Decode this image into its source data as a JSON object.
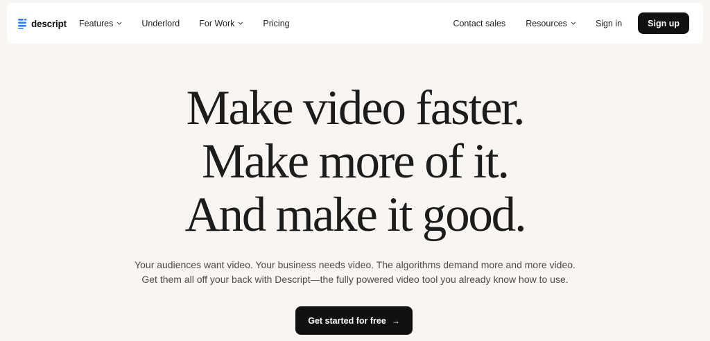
{
  "brand": {
    "name": "descript",
    "logo_icon": "descript-logo-icon",
    "accent": "#1a73e8"
  },
  "nav": {
    "left": [
      {
        "label": "Features",
        "has_dropdown": true
      },
      {
        "label": "Underlord",
        "has_dropdown": false
      },
      {
        "label": "For Work",
        "has_dropdown": true
      },
      {
        "label": "Pricing",
        "has_dropdown": false
      }
    ],
    "right": {
      "contact": "Contact sales",
      "resources": "Resources",
      "signin": "Sign in",
      "signup": "Sign up"
    }
  },
  "hero": {
    "lines": [
      "Make video faster.",
      "Make more of it.",
      "And make it good."
    ],
    "subtext": [
      "Your audiences want video. Your business needs video. The algorithms demand more and more video.",
      "Get them all off your back with Descript—the fully powered video tool you already know how to use."
    ],
    "cta_label": "Get started for free",
    "cta_icon": "arrow-right-icon"
  },
  "colors": {
    "background": "#f8f5f3",
    "nav_bg": "#ffffff",
    "button_bg": "#111111",
    "button_text": "#ffffff"
  }
}
